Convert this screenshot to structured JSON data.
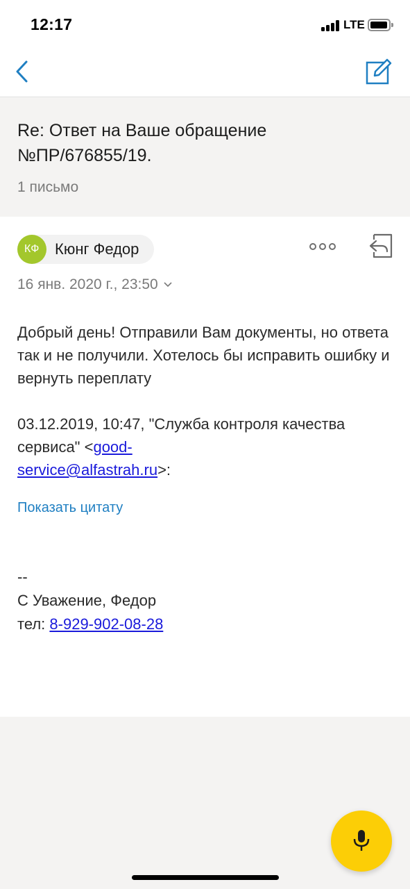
{
  "status_bar": {
    "time": "12:17",
    "network": "LTE"
  },
  "nav": {
    "back_icon": "chevron-left-icon",
    "compose_icon": "compose-icon",
    "accent": "#1f7fc2"
  },
  "thread": {
    "subject": "Re: Ответ на Ваше обращение №ПР/676855/19.",
    "count": "1 письмо"
  },
  "message": {
    "sender_initials": "КФ",
    "sender_name": "Кюнг Федор",
    "date": "16 янв. 2020 г., 23:50",
    "body_line1": "Добрый день! Отправили Вам документы, но ответа так и не получили. Хотелось бы исправить ошибку и вернуть переплату",
    "quote_prefix": "03.12.2019, 10:47, \"Служба контроля качества сервиса\" <",
    "quote_email_part1": "good-",
    "quote_email_part2": "service@alfastrah.ru",
    "quote_suffix": ">:",
    "show_quote": "Показать цитату",
    "sig_dashes": "--",
    "sig_name": "С Уважение, Федор",
    "sig_phone_label": "тел: ",
    "sig_phone": "8-929-902-08-28"
  },
  "fab": {
    "icon": "microphone-icon",
    "color": "#fcce06"
  }
}
